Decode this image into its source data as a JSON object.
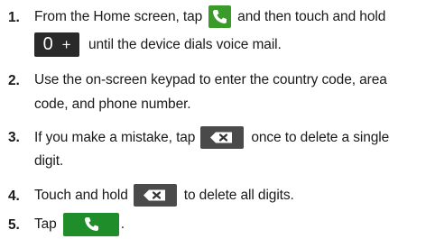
{
  "steps": [
    {
      "number": "1.",
      "line1_before": "From the Home screen, tap",
      "line1_after": "and then touch and hold",
      "key_zero": "0",
      "key_plus": "+",
      "line2_after": "until the device dials voice mail."
    },
    {
      "number": "2.",
      "line1": "Use the on-screen keypad to enter the country code, area",
      "line2": "code, and phone number."
    },
    {
      "number": "3.",
      "line1_before": "If you make a mistake, tap",
      "line1_after": "once to delete a single",
      "line2": "digit."
    },
    {
      "number": "4.",
      "line1_before": "Touch and hold",
      "line1_after": "to delete all digits."
    },
    {
      "number": "5.",
      "line1_before": "Tap",
      "line1_after": "."
    }
  ],
  "icons": {
    "phone_app": "phone-icon",
    "dial_key": "zero-plus-key-icon",
    "delete": "delete-backspace-icon",
    "call": "call-button-icon"
  },
  "colors": {
    "phone_green": "#3b9b2a",
    "call_green": "#1f8e2a",
    "delete_gray": "#4a4a4a",
    "key_dark": "#2a2a2a"
  }
}
